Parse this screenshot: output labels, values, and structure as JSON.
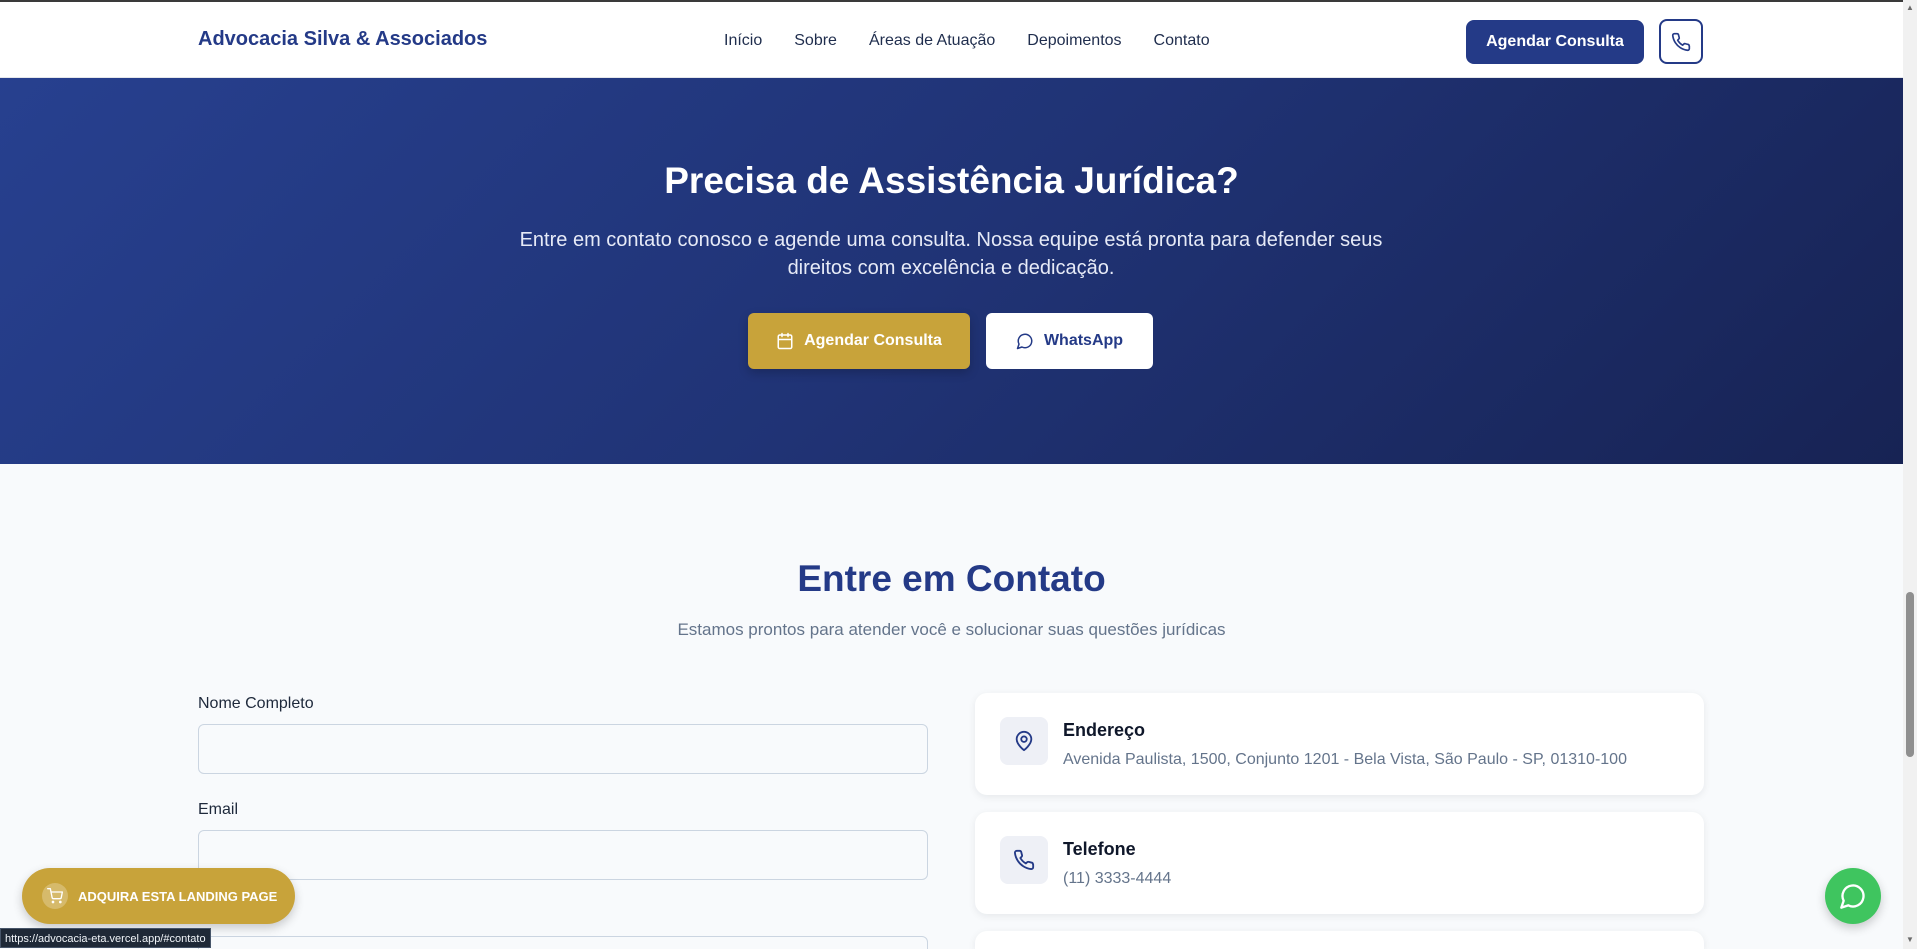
{
  "header": {
    "brand": "Advocacia Silva & Associados",
    "nav": [
      "Início",
      "Sobre",
      "Áreas de Atuação",
      "Depoimentos",
      "Contato"
    ],
    "cta_label": "Agendar Consulta",
    "phone_icon": "phone-icon"
  },
  "hero": {
    "title": "Precisa de Assistência Jurídica?",
    "text": "Entre em contato conosco e agende uma consulta. Nossa equipe está pronta para defender seus direitos com excelência e dedicação.",
    "primary_button": "Agendar Consulta",
    "secondary_button": "WhatsApp"
  },
  "contact": {
    "title": "Entre em Contato",
    "subtitle": "Estamos prontos para atender você e solucionar suas questões jurídicas",
    "form": {
      "name_label": "Nome Completo",
      "name_value": "",
      "email_label": "Email",
      "email_value": ""
    },
    "cards": [
      {
        "icon": "map-pin-icon",
        "title": "Endereço",
        "text": "Avenida Paulista, 1500, Conjunto 1201 - Bela Vista, São Paulo - SP, 01310-100"
      },
      {
        "icon": "phone-icon",
        "title": "Telefone",
        "text": "(11) 3333-4444"
      }
    ]
  },
  "floating": {
    "buy_label": "ADQUIRA ESTA LANDING PAGE",
    "whatsapp_icon": "whatsapp-icon"
  },
  "status_bar": {
    "url": "https://advocacia-eta.vercel.app/#contato"
  },
  "colors": {
    "primary": "#243a87",
    "gold": "#c8a33a",
    "whatsapp": "#3fc55f",
    "background": "#f8fafc"
  }
}
